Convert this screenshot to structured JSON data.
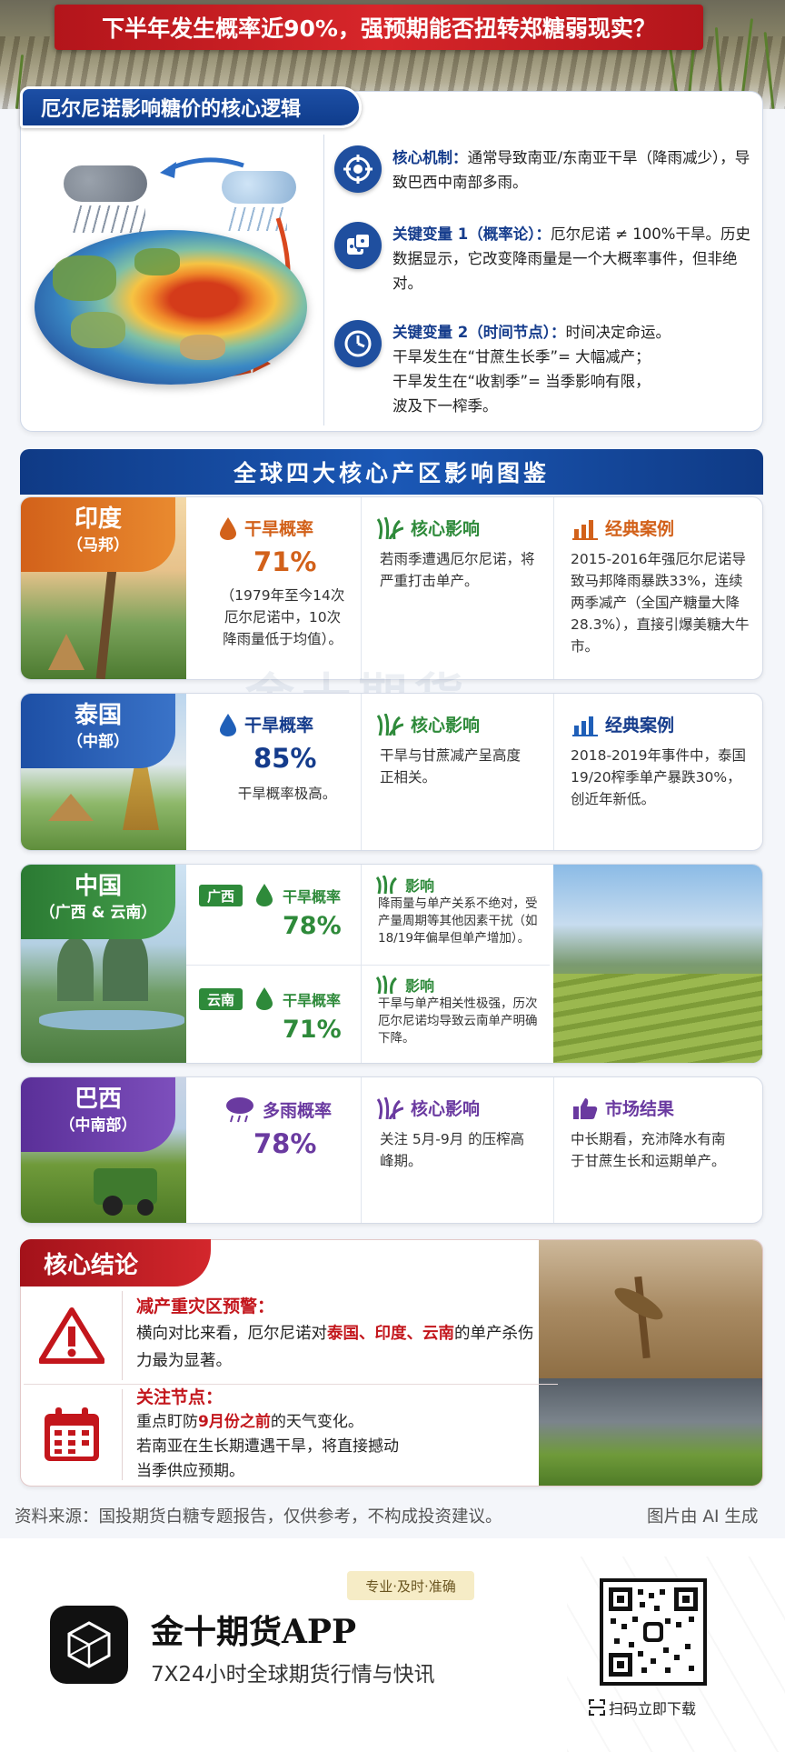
{
  "header": {
    "title": "下半年发生概率近90%，强预期能否扭转郑糖弱现实？"
  },
  "logic": {
    "title": "厄尔尼诺影响糖价的核心逻辑",
    "items": [
      {
        "icon": "target-icon",
        "label": "核心机制：",
        "text": "通常导致南亚/东南亚干旱（降雨减少），导致巴西中南部多雨。"
      },
      {
        "icon": "dice-icon",
        "label": "关键变量 1（概率论）：",
        "text": "厄尔尼诺 ≠ 100%干旱。历史数据显示，它改变降雨量是一个大概率事件，但非绝对。"
      },
      {
        "icon": "clock-icon",
        "label": "关键变量 2（时间节点）：",
        "text": "时间决定命运。",
        "line2": "干旱发生在“甘蔗生长季”= 大幅减产；",
        "line3": "干旱发生在“收割季”= 当季影响有限，",
        "line4": "波及下一榨季。"
      }
    ]
  },
  "regions": {
    "title": "全球四大核心产区影响图鉴",
    "india": {
      "name": "印度",
      "sub": "（马邦）",
      "h1": "干旱概率",
      "v1": "71%",
      "n1": "（1979年至今14次厄尔尼诺中，10次降雨量低于均值）。",
      "h2": "核心影响",
      "t2": "若雨季遭遇厄尔尼诺，将严重打击单产。",
      "h3": "经典案例",
      "t3": "2015-2016年强厄尔尼诺导致马邦降雨暴跌33%，连续两季减产（全国产糖量大降28.3%），直接引爆美糖大牛市。"
    },
    "thailand": {
      "name": "泰国",
      "sub": "（中部）",
      "h1": "干旱概率",
      "v1": "85%",
      "n1": "干旱概率极高。",
      "h2": "核心影响",
      "t2": "干旱与甘蔗减产呈高度正相关。",
      "h3": "经典案例",
      "t3": "2018-2019年事件中，泰国19/20榨季单产暴跌30%，创近年新低。"
    },
    "china": {
      "name": "中国",
      "sub": "（广西 & 云南）",
      "gx": {
        "tag": "广西",
        "h": "干旱概率",
        "v": "78%",
        "ih": "影响",
        "it": "降雨量与单产关系不绝对，受产量周期等其他因素干扰（如18/19年偏旱但单产增加）。"
      },
      "yn": {
        "tag": "云南",
        "h": "干旱概率",
        "v": "71%",
        "ih": "影响",
        "it": "干旱与单产相关性极强，历次厄尔尼诺均导致云南单产明确下降。"
      }
    },
    "brazil": {
      "name": "巴西",
      "sub": "（中南部）",
      "h1": "多雨概率",
      "v1": "78%",
      "h2": "核心影响",
      "t2": "关注 5月-9月 的压榨高峰期。",
      "h3": "市场结果",
      "t3": "中长期看，充沛降水有南于甘蔗生长和运期单产。"
    }
  },
  "conclusion": {
    "title": "核心结论",
    "w_title": "减产重灾区预警：",
    "w_pre": "横向对比来看，厄尔尼诺对",
    "w_hl": "泰国、印度、云南",
    "w_post": "的单产杀伤力最为显著。",
    "f_title": "关注节点：",
    "f_pre": "重点盯防",
    "f_hl": "9月份之前",
    "f_post": "的天气变化。",
    "f_line2": "若南亚在生长期遭遇干旱，将直接撼动",
    "f_line3": "当季供应预期。"
  },
  "source": {
    "left": "资料来源：国投期货白糖专题报告，仅供参考，不构成投资建议。",
    "right": "图片由 AI 生成"
  },
  "watermark": "金十期货",
  "footer": {
    "slogan": "专业·及时·准确",
    "app": "金十期货APP",
    "sub": "7X24小时全球期货行情与快讯",
    "scan": "扫码立即下载"
  },
  "colors": {
    "navy": "#153c8c",
    "orange": "#d2611a",
    "green": "#2e8a3a",
    "purple": "#6a3aa0",
    "red": "#c3161c"
  }
}
